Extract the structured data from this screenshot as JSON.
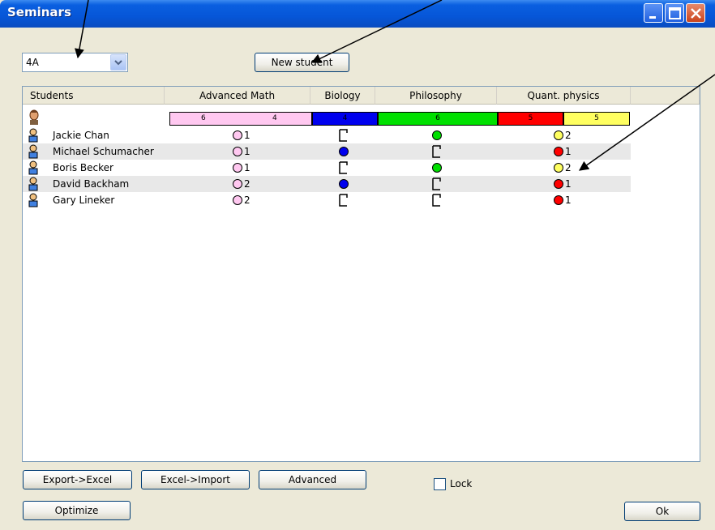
{
  "window": {
    "title": "Seminars"
  },
  "class_select": {
    "value": "4A"
  },
  "toolbar": {
    "new_student_label": "New student"
  },
  "grid": {
    "columns": [
      "Students",
      "Advanced Math",
      "Biology",
      "Philosophy",
      "Quant. physics"
    ],
    "capacity": {
      "advanced_math": [
        "6",
        "4"
      ],
      "biology": [
        "4"
      ],
      "philosophy": [
        "6"
      ],
      "quant_physics": [
        "5",
        "5"
      ]
    },
    "rows": [
      {
        "name": "Jackie Chan",
        "math": "1",
        "quant": "2"
      },
      {
        "name": "Michael Schumacher",
        "math": "1",
        "quant": "1"
      },
      {
        "name": "Boris Becker",
        "math": "1",
        "quant": "2"
      },
      {
        "name": "David Backham",
        "math": "2",
        "quant": "1"
      },
      {
        "name": "Gary Lineker",
        "math": "2",
        "quant": "1"
      }
    ]
  },
  "footer": {
    "export_label": "Export->Excel",
    "import_label": "Excel->Import",
    "advanced_label": "Advanced",
    "lock_label": "Lock",
    "optimize_label": "Optimize",
    "ok_label": "Ok"
  },
  "colors": {
    "titlebar": "#0656d8",
    "math_pink": "#ffc8f0",
    "biology_blue": "#0000ee",
    "philosophy_green": "#00e000",
    "quant_red": "#ff0000",
    "quant_yellow": "#ffff60"
  }
}
